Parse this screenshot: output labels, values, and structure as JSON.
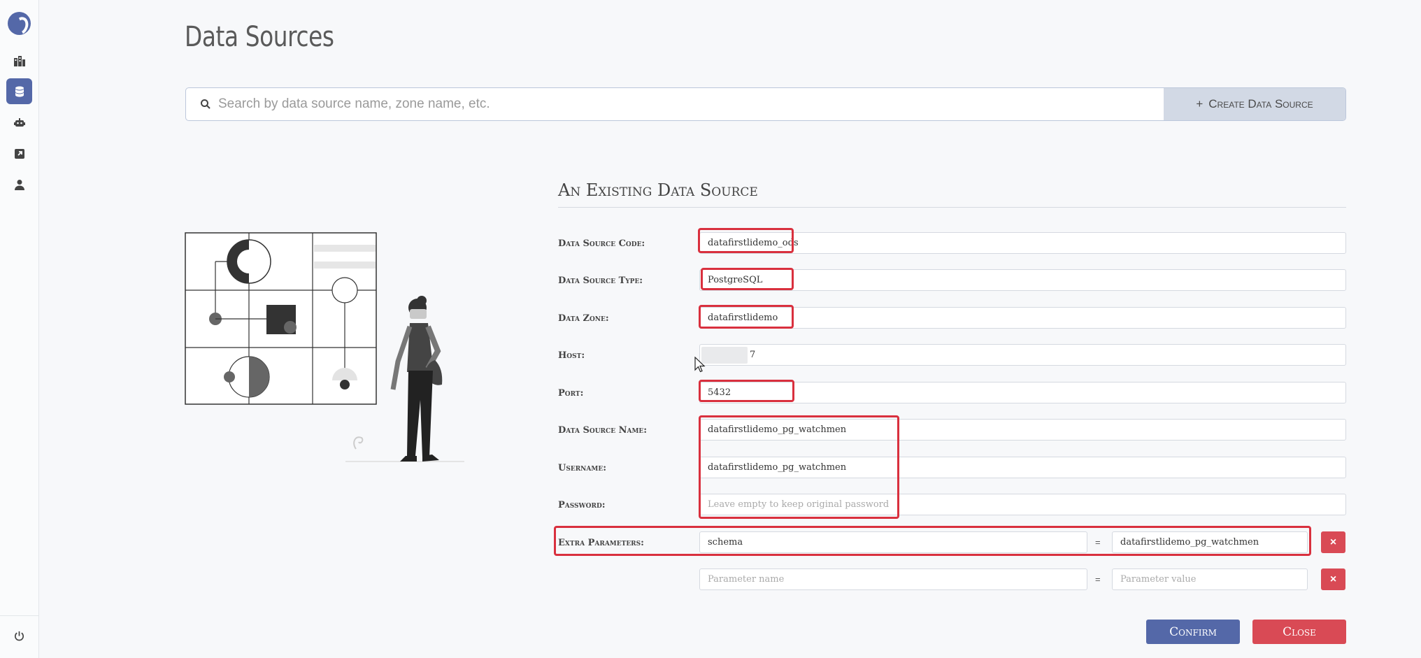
{
  "page_title": "Data Sources",
  "search": {
    "placeholder": "Search by data source name, zone name, etc.",
    "create_label": "Create Data Source",
    "create_prefix": "+"
  },
  "form": {
    "title": "An Existing Data Source",
    "fields": {
      "code": {
        "label": "Data Source Code:",
        "value": "datafirstlidemo_ods"
      },
      "type": {
        "label": "Data Source Type:",
        "value": "PostgreSQL"
      },
      "zone": {
        "label": "Data Zone:",
        "value": "datafirstlidemo"
      },
      "host": {
        "label": "Host:",
        "value": "7"
      },
      "port": {
        "label": "Port:",
        "value": "5432"
      },
      "name": {
        "label": "Data Source Name:",
        "value": "datafirstlidemo_pg_watchmen"
      },
      "username": {
        "label": "Username:",
        "value": "datafirstlidemo_pg_watchmen"
      },
      "password": {
        "label": "Password:",
        "value": "",
        "placeholder": "Leave empty to keep original password"
      }
    },
    "extra_parameters": {
      "label": "Extra Parameters:",
      "rows": [
        {
          "name": "schema",
          "value": "datafirstlidemo_pg_watchmen"
        },
        {
          "name": "",
          "value": ""
        }
      ],
      "name_placeholder": "Parameter name",
      "value_placeholder": "Parameter value",
      "equals": "=",
      "remove_symbol": "×"
    },
    "confirm_label": "Confirm",
    "close_label": "Close"
  },
  "colors": {
    "accent": "#5468a8",
    "danger": "#d94a55",
    "highlight": "#d9303e"
  },
  "icons": [
    "logo-icon",
    "building-icon",
    "database-icon",
    "robot-icon",
    "external-link-icon",
    "user-icon",
    "power-icon",
    "search-icon"
  ]
}
